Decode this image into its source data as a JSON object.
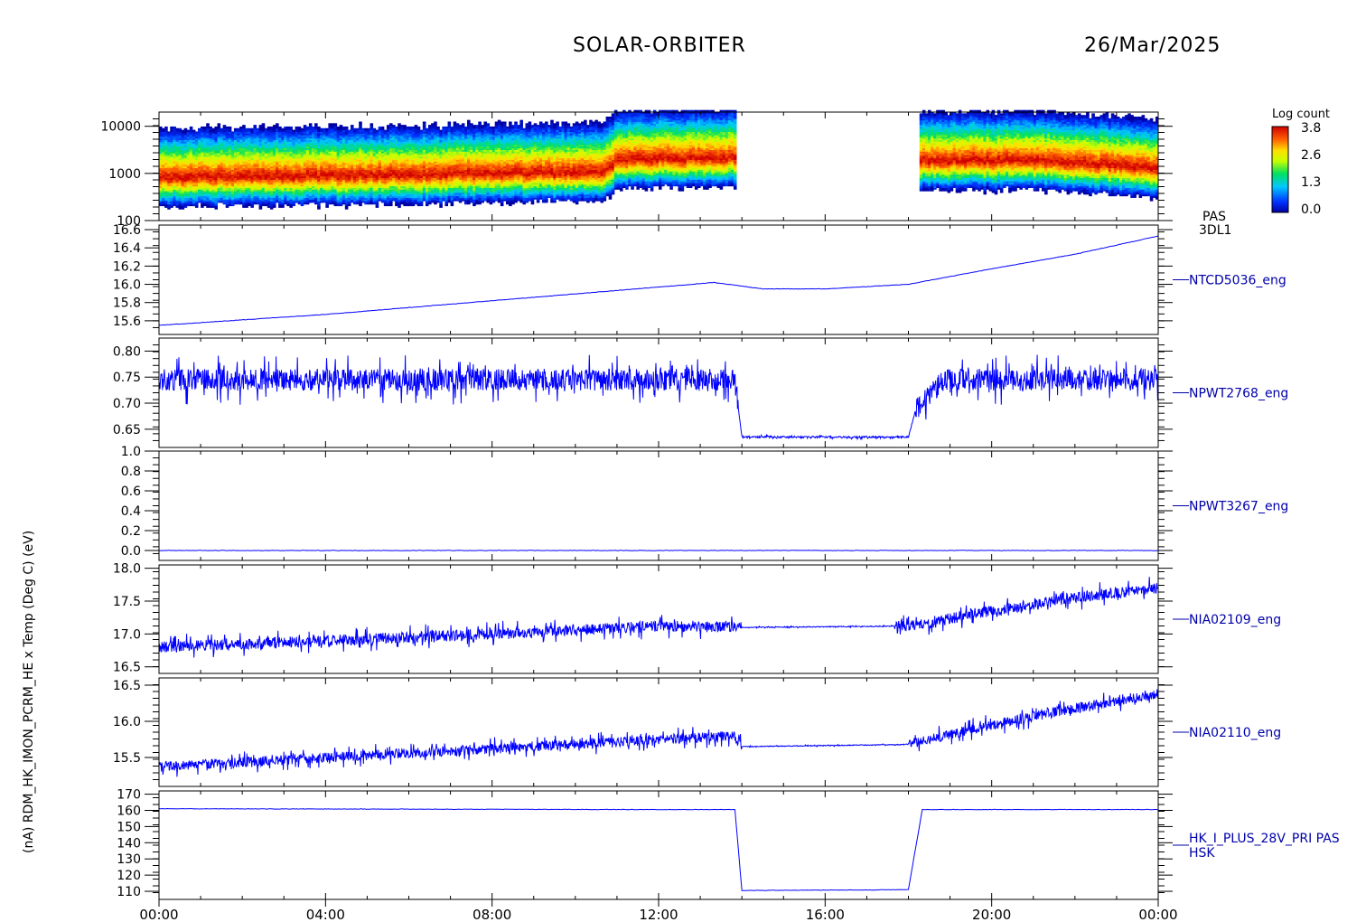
{
  "header": {
    "mission": "SOLAR-ORBITER",
    "date": "26/Mar/2025"
  },
  "colorbar": {
    "title": "Log count",
    "ticks": [
      "3.8",
      "2.6",
      "1.3",
      "0.0"
    ]
  },
  "y_axis_overlap_label": "(nA)",
  "colors": {
    "trace": "#0000ff",
    "axis": "#000000",
    "panel_label": "#0000aa"
  },
  "chart_data": [
    {
      "type": "heatmap",
      "panel_label": [
        "PAS",
        "3DL1"
      ],
      "ylabel": "(eV)",
      "yscale": "log",
      "ylim": [
        100,
        20000
      ],
      "ytick_labels": [
        "10000",
        "1000",
        "100"
      ],
      "xlim": [
        "00:00",
        "24:00"
      ],
      "data_gap": [
        "13:50",
        "18:15"
      ],
      "peak_energy_eV": [
        {
          "time": "00:00",
          "energy": 800
        },
        {
          "time": "06:00",
          "energy": 900
        },
        {
          "time": "10:40",
          "energy": 1050
        },
        {
          "time": "11:00",
          "energy": 1900
        },
        {
          "time": "13:50",
          "energy": 2100
        },
        {
          "time": "18:15",
          "energy": 1800
        },
        {
          "time": "21:00",
          "energy": 1800
        },
        {
          "time": "24:00",
          "energy": 1250
        }
      ],
      "colorscale": "rainbow"
    },
    {
      "type": "line",
      "panel_label": "NTCD5036_eng",
      "ylabel": "x Temp (Deg C)",
      "ylim": [
        15.45,
        16.65
      ],
      "ytick_labels": [
        "16.6",
        "16.4",
        "16.2",
        "16.0",
        "15.8",
        "15.6"
      ],
      "x": [
        "00:00",
        "04:00",
        "08:00",
        "12:00",
        "13:20",
        "14:30",
        "16:00",
        "18:00",
        "20:00",
        "22:00",
        "24:00"
      ],
      "y": [
        15.55,
        15.67,
        15.82,
        15.97,
        16.02,
        15.95,
        15.95,
        16.0,
        16.17,
        16.33,
        16.53
      ]
    },
    {
      "type": "line",
      "panel_label": "NPWT2768_eng",
      "ylabel": "(A)",
      "ylim": [
        0.615,
        0.825
      ],
      "ytick_labels": [
        "0.80",
        "0.75",
        "0.70",
        "0.65"
      ],
      "x": [
        "00:00",
        "13:50",
        "14:00",
        "18:00",
        "18:10",
        "18:50",
        "24:00"
      ],
      "y": [
        0.745,
        0.745,
        0.635,
        0.635,
        0.685,
        0.745,
        0.745
      ],
      "noise_amplitude": 0.03
    },
    {
      "type": "line",
      "panel_label": "NPWT3267_eng",
      "ylabel": "(A)",
      "ylim": [
        -0.1,
        1.0
      ],
      "ytick_labels": [
        "1.0",
        "0.8",
        "0.6",
        "0.4",
        "0.2",
        "0.0"
      ],
      "x": [
        "00:00",
        "24:00"
      ],
      "y": [
        0.0,
        0.0
      ]
    },
    {
      "type": "line",
      "panel_label": "NIA02109_eng",
      "ylabel": "(A)",
      "ylim": [
        16.4,
        18.05
      ],
      "ytick_labels": [
        "18.0",
        "17.5",
        "17.0",
        "16.5"
      ],
      "x": [
        "00:00",
        "04:00",
        "08:00",
        "12:00",
        "14:00",
        "18:00",
        "20:00",
        "22:00",
        "24:00"
      ],
      "y": [
        16.8,
        16.9,
        17.0,
        17.12,
        17.1,
        17.12,
        17.35,
        17.55,
        17.7
      ],
      "noise_amplitude": 0.12
    },
    {
      "type": "line",
      "panel_label": "NIA02110_eng",
      "ylabel": "(A)",
      "ylim": [
        15.1,
        16.6
      ],
      "ytick_labels": [
        "16.5",
        "16.0",
        "15.5"
      ],
      "x": [
        "00:00",
        "04:00",
        "08:00",
        "12:00",
        "13:50",
        "14:00",
        "18:00",
        "20:00",
        "22:00",
        "24:00"
      ],
      "y": [
        15.37,
        15.5,
        15.62,
        15.75,
        15.8,
        15.65,
        15.68,
        15.95,
        16.18,
        16.38
      ],
      "noise_amplitude": 0.1
    },
    {
      "type": "line",
      "panel_label": [
        "HK_I_PLUS_28V_PRI PAS",
        "HSK"
      ],
      "ylabel": "RDM_HK_IMON_PCRM_HE",
      "ylim": [
        105,
        172
      ],
      "ytick_labels": [
        "170",
        "160",
        "150",
        "140",
        "130",
        "120",
        "110"
      ],
      "x": [
        "00:00",
        "12:00",
        "13:50",
        "14:00",
        "18:00",
        "18:20",
        "24:00"
      ],
      "y": [
        161,
        160.5,
        160.5,
        110.5,
        111,
        160.5,
        160.5
      ]
    }
  ],
  "x_axis": {
    "tick_labels": [
      "00:00",
      "04:00",
      "08:00",
      "12:00",
      "16:00",
      "20:00",
      "00:00"
    ]
  }
}
